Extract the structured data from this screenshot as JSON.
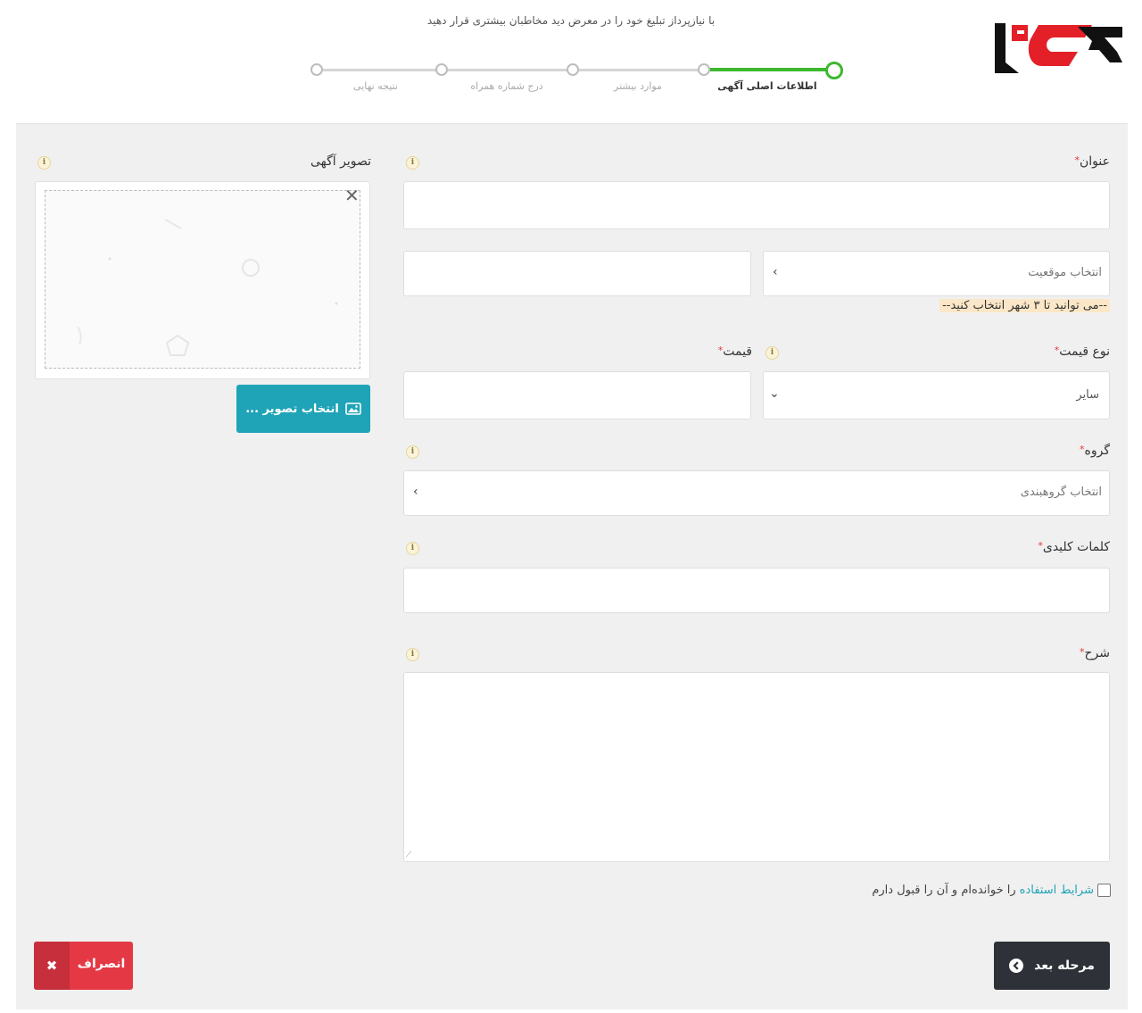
{
  "header": {
    "subtitle": "با نیازپرداز تبلیغ خود را در معرض دید مخاطبان بیشتری قرار دهید"
  },
  "stepper": {
    "steps": [
      {
        "label": "اطلاعات اصلی آگهی",
        "active": true
      },
      {
        "label": "موارد بیشتر",
        "active": false
      },
      {
        "label": "درج شماره همراه",
        "active": false
      },
      {
        "label": "نتیجه نهایی",
        "active": false
      }
    ],
    "accent_color": "#3cb82e"
  },
  "form": {
    "title_label": "عنوان",
    "title_value": "",
    "location_placeholder": "انتخاب موقعیت",
    "location_note": "--می توانید تا ۳ شهر انتخاب کنید--",
    "price_type_label": "نوع قیمت",
    "price_type_value": "سایر",
    "price_label": "قیمت",
    "group_label": "گروه",
    "group_placeholder": "انتخاب گروهبندی",
    "keywords_label": "کلمات کلیدی",
    "description_label": "شرح",
    "required_mark": "*",
    "info_mark": "i",
    "terms_link": "شرایط استفاده",
    "terms_text": "را خوانده‌ام و آن را قبول دارم",
    "terms_checked": false
  },
  "image": {
    "label": "تصویر آگهی",
    "choose_button": "انتخاب تصویر ...",
    "close_symbol": "✕"
  },
  "actions": {
    "next_label": "مرحله بعد",
    "cancel_label": "انصراف",
    "cancel_symbol": "✖",
    "next_color": "#2e3238",
    "cancel_color": "#e53845",
    "choose_color": "#1fa3b7"
  }
}
